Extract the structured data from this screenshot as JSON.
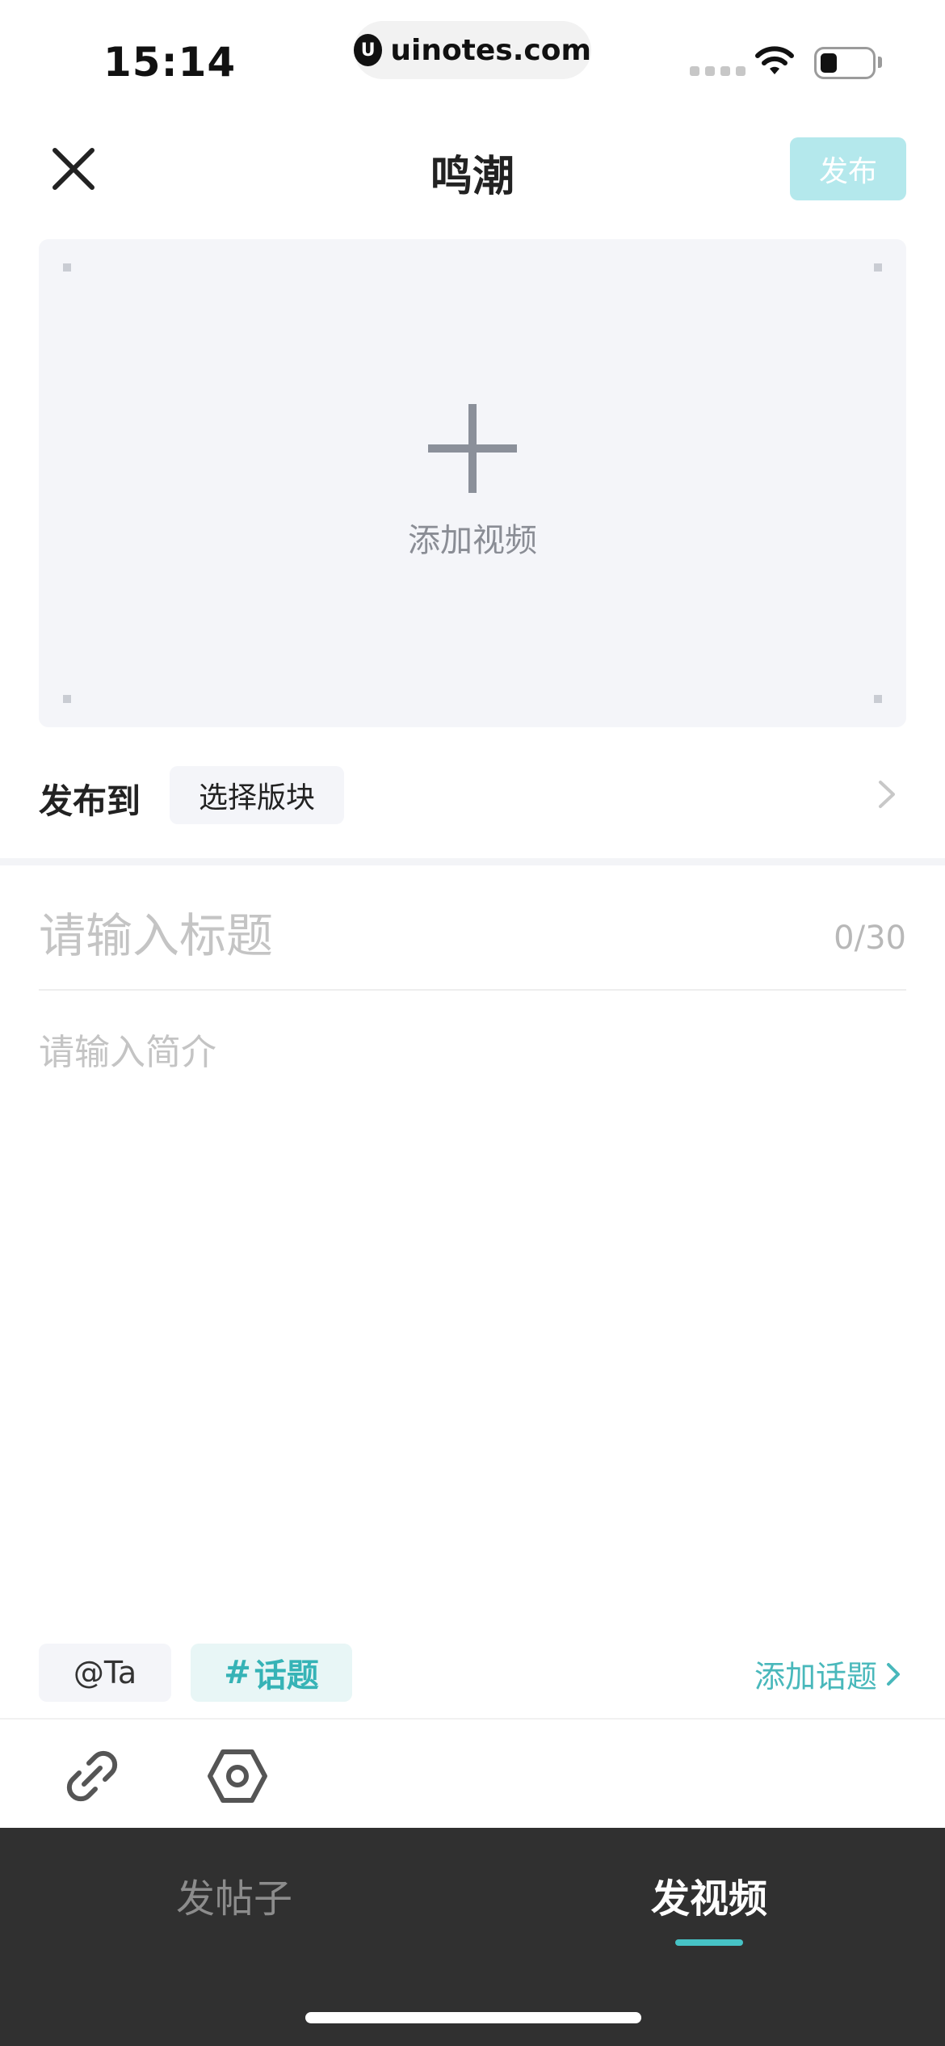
{
  "status_bar": {
    "time": "15:14",
    "url_logo": "U",
    "url": "uinotes.com"
  },
  "header": {
    "title": "鸣潮",
    "publish_label": "发布"
  },
  "video": {
    "add_label": "添加视频"
  },
  "publish_to": {
    "label": "发布到",
    "select_label": "选择版块"
  },
  "form": {
    "title_placeholder": "请输入标题",
    "title_counter": "0/30",
    "intro_placeholder": "请输入简介"
  },
  "tags": {
    "at_label": "@Ta",
    "topic_symbol": "#",
    "topic_label": "话题",
    "add_topic_label": "添加话题"
  },
  "tabs": [
    {
      "label": "发帖子",
      "active": false
    },
    {
      "label": "发视频",
      "active": true
    }
  ],
  "colors": {
    "accent": "#46c3c6",
    "publish_disabled": "#b4e8ec",
    "tabbar_bg": "#303030"
  },
  "icons": [
    "close-icon",
    "plus-icon",
    "chevron-right-icon",
    "link-icon",
    "hexagon-nut-icon",
    "wifi-icon",
    "battery-icon"
  ]
}
